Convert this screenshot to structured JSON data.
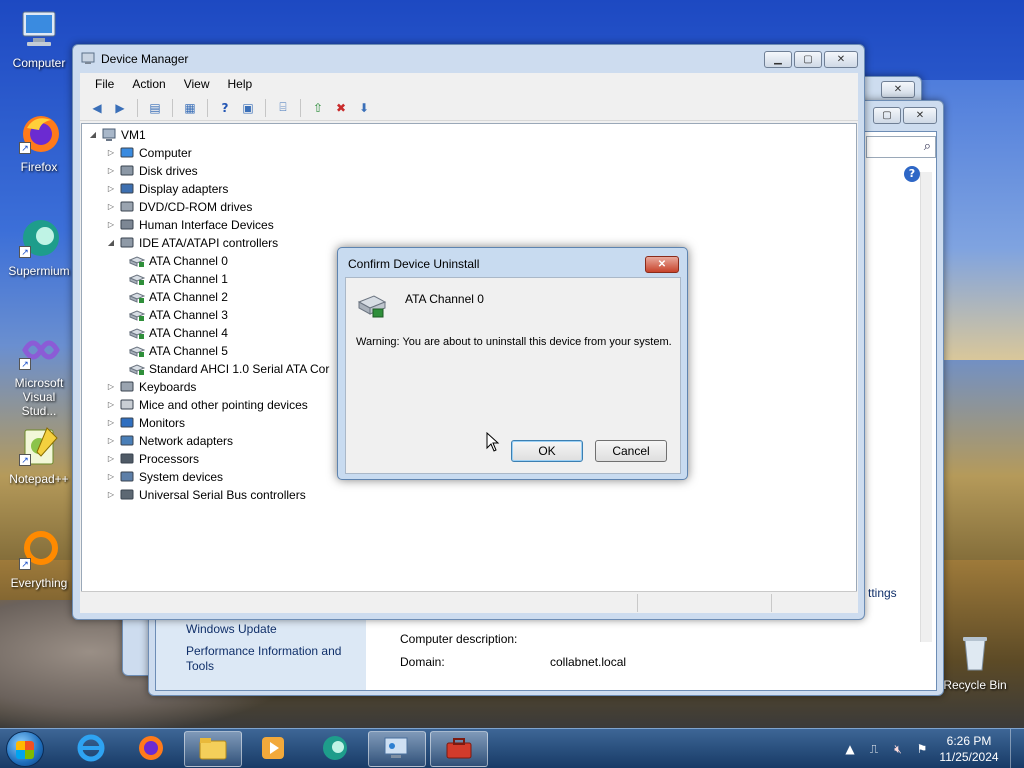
{
  "desktop": {
    "icons": [
      {
        "label": "Computer"
      },
      {
        "label": "Firefox"
      },
      {
        "label": "Supermium"
      },
      {
        "label_line1": "Microsoft",
        "label_line2": "Visual Stud..."
      },
      {
        "label": "Notepad++"
      },
      {
        "label": "Everything"
      },
      {
        "label": "Recycle Bin"
      }
    ]
  },
  "background_window": {
    "links": [
      "Windows Update",
      "Performance Information and",
      "Tools"
    ],
    "settings_link": "ttings",
    "rows": [
      {
        "label": "Computer description:",
        "value": ""
      },
      {
        "label": "Domain:",
        "value": "collabnet.local"
      }
    ]
  },
  "device_manager": {
    "title": "Device Manager",
    "menu": [
      "File",
      "Action",
      "View",
      "Help"
    ],
    "root": "VM1",
    "tree": [
      {
        "label": "Computer",
        "icon": "computer-icon",
        "expanded": false
      },
      {
        "label": "Disk drives",
        "icon": "disk-drive-icon",
        "expanded": false
      },
      {
        "label": "Display adapters",
        "icon": "display-adapter-icon",
        "expanded": false
      },
      {
        "label": "DVD/CD-ROM drives",
        "icon": "dvd-drive-icon",
        "expanded": false
      },
      {
        "label": "Human Interface Devices",
        "icon": "hid-icon",
        "expanded": false
      },
      {
        "label": "IDE ATA/ATAPI controllers",
        "icon": "ide-controller-icon",
        "expanded": true,
        "children": [
          "ATA Channel 0",
          "ATA Channel 1",
          "ATA Channel 2",
          "ATA Channel 3",
          "ATA Channel 4",
          "ATA Channel 5",
          "Standard AHCI 1.0 Serial ATA Cor"
        ]
      },
      {
        "label": "Keyboards",
        "icon": "keyboard-icon",
        "expanded": false
      },
      {
        "label": "Mice and other pointing devices",
        "icon": "mouse-icon",
        "expanded": false
      },
      {
        "label": "Monitors",
        "icon": "monitor-icon",
        "expanded": false
      },
      {
        "label": "Network adapters",
        "icon": "network-adapter-icon",
        "expanded": false
      },
      {
        "label": "Processors",
        "icon": "processor-icon",
        "expanded": false
      },
      {
        "label": "System devices",
        "icon": "system-device-icon",
        "expanded": false
      },
      {
        "label": "Universal Serial Bus controllers",
        "icon": "usb-icon",
        "expanded": false
      }
    ]
  },
  "dialog": {
    "title": "Confirm Device Uninstall",
    "device_name": "ATA Channel 0",
    "warning": "Warning: You are about to uninstall this device from your system.",
    "ok_label": "OK",
    "cancel_label": "Cancel"
  },
  "taskbar": {
    "time": "6:26 PM",
    "date": "11/25/2024"
  },
  "colors": {
    "accent": "#3c7fb1",
    "link": "#11306a",
    "close_red": "#c7432b"
  }
}
